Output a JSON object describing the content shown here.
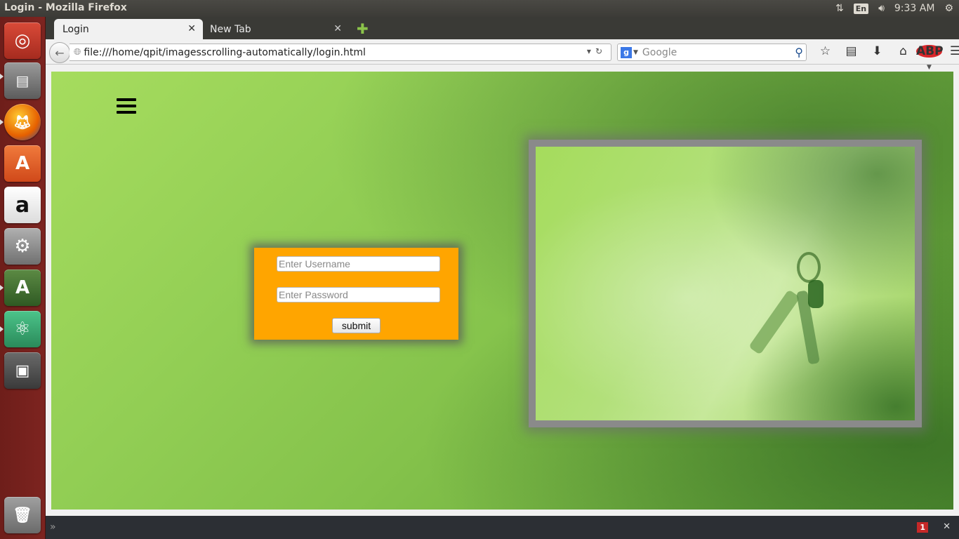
{
  "system": {
    "window_title": "Login - Mozilla Firefox",
    "keyboard_layout": "En",
    "clock": "9:33 AM",
    "icons": [
      "network-icon",
      "volume-icon",
      "settings-gear-icon"
    ]
  },
  "launcher": {
    "items": [
      {
        "name": "ubuntu-dash",
        "icon": "ubuntu-logo-icon",
        "color": "#c7372b"
      },
      {
        "name": "files",
        "icon": "file-cabinet-icon",
        "color": "#7a7a7a"
      },
      {
        "name": "firefox",
        "icon": "firefox-icon",
        "color": "#e66000"
      },
      {
        "name": "software-center",
        "icon": "shopping-bag-icon",
        "color": "#e8602c"
      },
      {
        "name": "amazon",
        "icon": "amazon-icon",
        "color": "#f0f0f0"
      },
      {
        "name": "system-settings",
        "icon": "wrench-gear-icon",
        "color": "#9a9a9a"
      },
      {
        "name": "software-updater",
        "icon": "updater-icon",
        "color": "#4a4a4a"
      },
      {
        "name": "atom",
        "icon": "atom-icon",
        "color": "#3aa76d"
      },
      {
        "name": "save",
        "icon": "floppy-disk-icon",
        "color": "#555"
      },
      {
        "name": "trash",
        "icon": "trash-icon",
        "color": "#888"
      }
    ]
  },
  "browser": {
    "tabs": [
      {
        "label": "Login",
        "active": true
      },
      {
        "label": "New Tab",
        "active": false
      }
    ],
    "url": "file:///home/qpit/imagesscrolling-automatically/login.html",
    "search_placeholder": "Google",
    "toolbar_icons": [
      "bookmark-star-icon",
      "reading-list-icon",
      "download-icon",
      "home-icon",
      "adblock-icon",
      "menu-icon"
    ],
    "adblock_label": "ABP"
  },
  "page": {
    "menu_icon": "hamburger-icon",
    "login": {
      "username_placeholder": "Enter Username",
      "password_placeholder": "Enter Password",
      "submit_label": "submit",
      "box_color": "#ffa500"
    },
    "background_colors": [
      "#a6dc5e",
      "#5e9d36"
    ]
  },
  "addon_bar": {
    "badge_count": "1"
  }
}
